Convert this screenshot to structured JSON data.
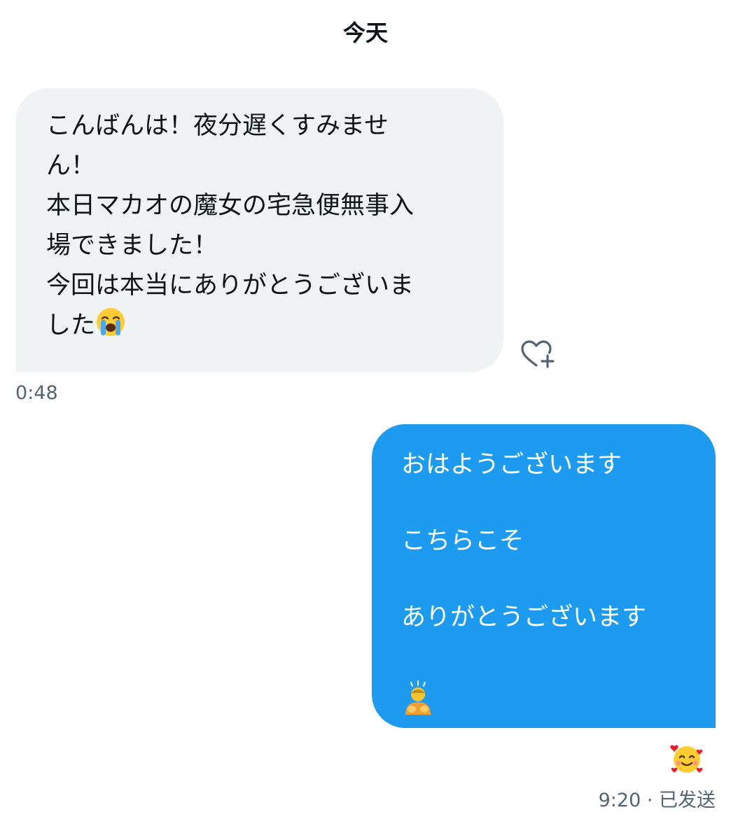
{
  "date_divider": "今天",
  "incoming": {
    "lines": [
      "こんばんは！夜分遅くすみませ",
      "ん！",
      "本日マカオの魔女の宅急便無事入",
      "場できました！",
      "今回は本当にありがとうございま",
      "した"
    ],
    "emoji": "loudly-crying-face",
    "time": "0:48",
    "action_icon": "heart-plus-icon"
  },
  "outgoing": {
    "lines": [
      "おはようございます",
      "こちらこそ",
      "ありがとうございます"
    ],
    "emoji": "person-bowing",
    "reaction": "smiling-face-with-hearts",
    "time": "9:20 · 已发送"
  },
  "colors": {
    "incoming_bubble": "#eff3f4",
    "outgoing_bubble": "#1d9bf0",
    "text": "#0f1419",
    "secondary_text": "#536471"
  }
}
